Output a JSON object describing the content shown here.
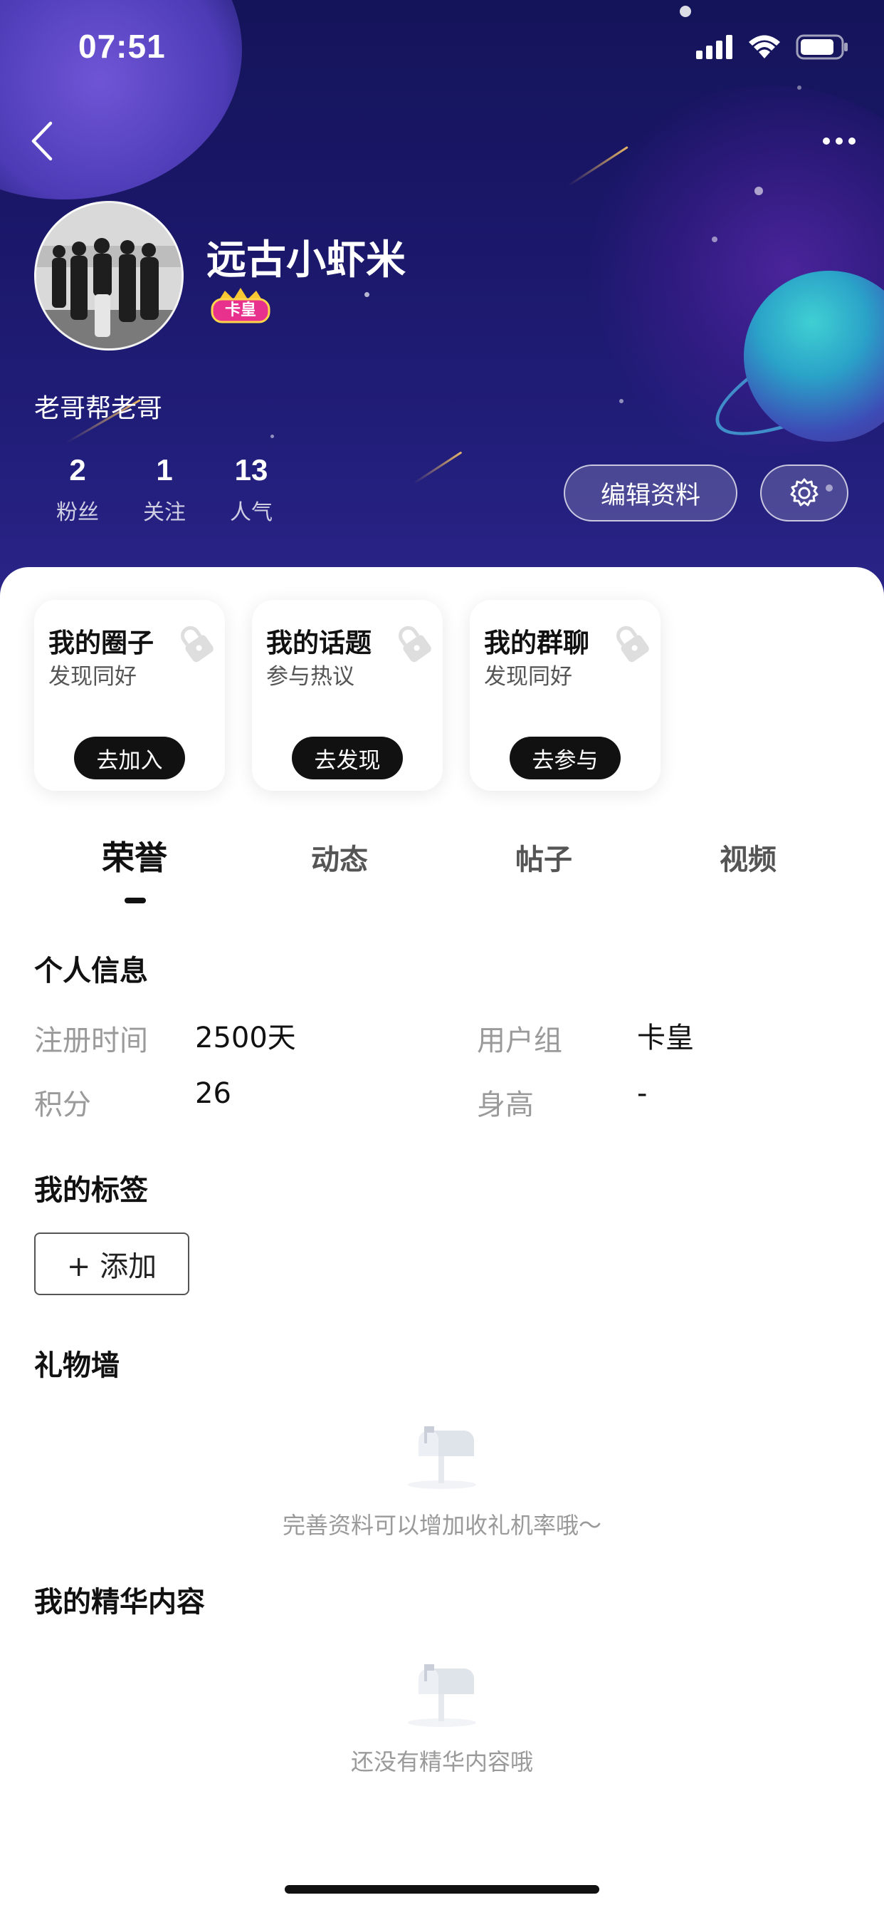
{
  "status_bar": {
    "time": "07:51",
    "icons": [
      "cellular-signal-icon",
      "wifi-icon",
      "battery-icon"
    ]
  },
  "nav": {
    "back_icon": "chevron-left-icon",
    "more_icon": "more-dots-icon"
  },
  "profile": {
    "username": "远古小虾米",
    "badge_text": "卡皇",
    "bio": "老哥帮老哥",
    "stats": [
      {
        "value": "2",
        "label": "粉丝"
      },
      {
        "value": "1",
        "label": "关注"
      },
      {
        "value": "13",
        "label": "人气"
      }
    ],
    "edit_button": "编辑资料",
    "settings_icon": "gear-icon"
  },
  "cards": [
    {
      "title": "我的圈子",
      "subtitle": "发现同好",
      "button": "去加入"
    },
    {
      "title": "我的话题",
      "subtitle": "参与热议",
      "button": "去发现"
    },
    {
      "title": "我的群聊",
      "subtitle": "发现同好",
      "button": "去参与"
    }
  ],
  "tabs": [
    {
      "label": "荣誉",
      "active": true
    },
    {
      "label": "动态",
      "active": false
    },
    {
      "label": "帖子",
      "active": false
    },
    {
      "label": "视频",
      "active": false
    }
  ],
  "personal_info": {
    "title": "个人信息",
    "fields": [
      {
        "label": "注册时间",
        "value": "2500天"
      },
      {
        "label": "用户组",
        "value": "卡皇"
      },
      {
        "label": "积分",
        "value": "26"
      },
      {
        "label": "身高",
        "value": "-"
      }
    ]
  },
  "tags": {
    "title": "我的标签",
    "add_button": "+ 添加"
  },
  "gift_wall": {
    "title": "礼物墙",
    "empty_text": "完善资料可以增加收礼机率哦～"
  },
  "featured": {
    "title": "我的精华内容",
    "empty_text": "还没有精华内容哦"
  },
  "colors": {
    "hero_bg": "#1a1768",
    "accent_dark": "#111111",
    "muted_text": "#9a9a9a",
    "badge_pink": "#e8318c"
  }
}
